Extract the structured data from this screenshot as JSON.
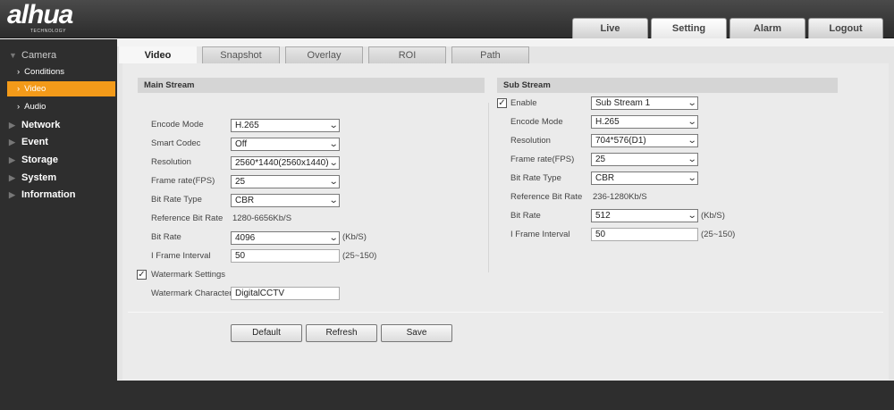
{
  "header": {
    "logo_text": "alhua",
    "logo_sub": "TECHNOLOGY",
    "tabs": [
      "Live",
      "Setting",
      "Alarm",
      "Logout"
    ],
    "active_tab": "Setting"
  },
  "sidebar": {
    "camera": "Camera",
    "sub_items": [
      "Conditions",
      "Video",
      "Audio"
    ],
    "active_sub": "Video",
    "sections": [
      "Network",
      "Event",
      "Storage",
      "System",
      "Information"
    ]
  },
  "tabs": [
    "Video",
    "Snapshot",
    "Overlay",
    "ROI",
    "Path"
  ],
  "active_tab": "Video",
  "help_icon": "?",
  "main_stream": {
    "title": "Main Stream",
    "encode_mode": {
      "label": "Encode Mode",
      "value": "H.265"
    },
    "smart_codec": {
      "label": "Smart Codec",
      "value": "Off"
    },
    "resolution": {
      "label": "Resolution",
      "value": "2560*1440(2560x1440)"
    },
    "frame_rate": {
      "label": "Frame rate(FPS)",
      "value": "25"
    },
    "bit_rate_type": {
      "label": "Bit Rate Type",
      "value": "CBR"
    },
    "ref_bit_rate": {
      "label": "Reference Bit Rate",
      "value": "1280-6656Kb/S"
    },
    "bit_rate": {
      "label": "Bit Rate",
      "value": "4096",
      "unit": "(Kb/S)"
    },
    "iframe": {
      "label": "I Frame Interval",
      "value": "50",
      "range": "(25~150)"
    },
    "watermark_settings": {
      "label": "Watermark Settings",
      "checked": true
    },
    "watermark_char": {
      "label": "Watermark Character",
      "value": "DigitalCCTV"
    }
  },
  "sub_stream": {
    "title": "Sub Stream",
    "enable": {
      "label": "Enable",
      "checked": true,
      "value": "Sub Stream 1"
    },
    "encode_mode": {
      "label": "Encode Mode",
      "value": "H.265"
    },
    "resolution": {
      "label": "Resolution",
      "value": "704*576(D1)"
    },
    "frame_rate": {
      "label": "Frame rate(FPS)",
      "value": "25"
    },
    "bit_rate_type": {
      "label": "Bit Rate Type",
      "value": "CBR"
    },
    "ref_bit_rate": {
      "label": "Reference Bit Rate",
      "value": "236-1280Kb/S"
    },
    "bit_rate": {
      "label": "Bit Rate",
      "value": "512",
      "unit": "(Kb/S)"
    },
    "iframe": {
      "label": "I Frame Interval",
      "value": "50",
      "range": "(25~150)"
    }
  },
  "buttons": {
    "default": "Default",
    "refresh": "Refresh",
    "save": "Save"
  }
}
